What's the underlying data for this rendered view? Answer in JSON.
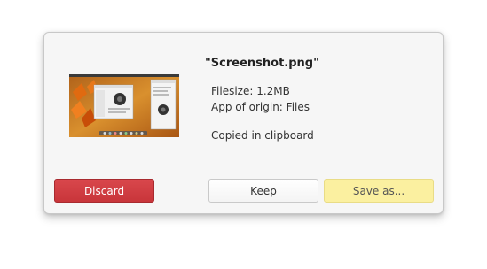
{
  "dialog": {
    "filename": "\"Screenshot.png\"",
    "filesize_text": "Filesize: 1.2MB",
    "origin_text": "App of origin: Files",
    "status_text": "Copied in clipboard",
    "thumbnail_icon": "screenshot-thumbnail"
  },
  "buttons": {
    "discard_label": "Discard",
    "keep_label": "Keep",
    "save_label": "Save as..."
  },
  "colors": {
    "discard": "#cc3b40",
    "save": "#fbf0a0",
    "keep": "#ffffff"
  }
}
